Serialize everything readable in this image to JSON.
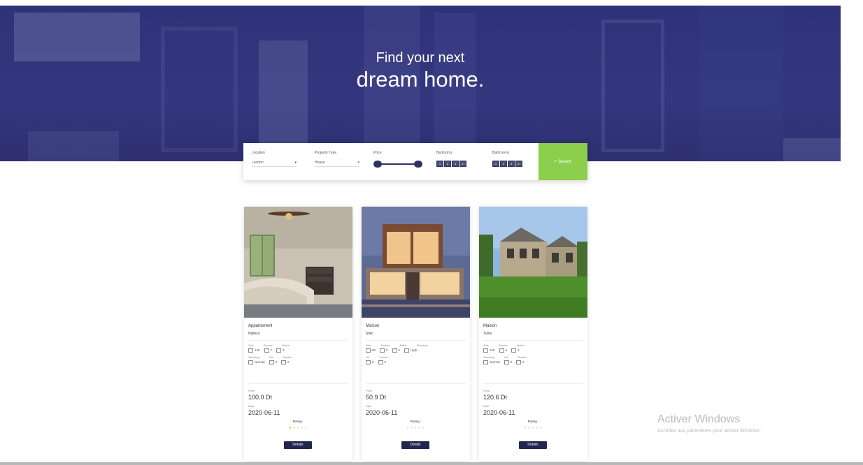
{
  "hero": {
    "line1": "Find your next",
    "line2": "dream home."
  },
  "search": {
    "location": {
      "label": "Location",
      "value": "London"
    },
    "property_type": {
      "label": "Property Type",
      "value": "House"
    },
    "price": {
      "label": "Price",
      "min_fraction": 0,
      "max_fraction": 1
    },
    "bedrooms": {
      "label": "Bedrooms",
      "options": [
        "1",
        "2",
        "3",
        "4+"
      ]
    },
    "bathrooms": {
      "label": "Bathrooms",
      "options": [
        "1",
        "2",
        "3",
        "4+"
      ]
    },
    "button_label": "Search",
    "accent_color": "#8ccf4d"
  },
  "cards": [
    {
      "type": "Appartement",
      "city": "Nabeul",
      "spec_headers": [
        "Size",
        "Rooms",
        "Baths"
      ],
      "specs": [
        {
          "icon": "area-icon",
          "value": "120"
        },
        {
          "icon": "bed-icon",
          "value": "7"
        },
        {
          "icon": "bath-icon",
          "value": "3"
        }
      ],
      "spec_headers2": [
        "Standing",
        "Lift",
        "Garden"
      ],
      "specs2": [
        {
          "icon": "standing-icon",
          "value": "Normal"
        },
        {
          "icon": "lift-icon",
          "value": "0"
        },
        {
          "icon": "garden-icon",
          "value": "0"
        }
      ],
      "price_label": "Price",
      "price": "100.0 Dt",
      "date_label": "Date",
      "date": "2020-06-11",
      "rating_label": "Rating :",
      "rating": 1,
      "details_label": "Details"
    },
    {
      "type": "Maison",
      "city": "Sfax",
      "spec_headers": [
        "Size",
        "Rooms",
        "Baths",
        "Standing"
      ],
      "specs": [
        {
          "icon": "area-icon",
          "value": "90"
        },
        {
          "icon": "bed-icon",
          "value": "6"
        },
        {
          "icon": "bath-icon",
          "value": "2"
        },
        {
          "icon": "standing-icon",
          "value": "High"
        }
      ],
      "spec_headers2": [
        "Lift",
        "Garden"
      ],
      "specs2": [
        {
          "icon": "lift-icon",
          "value": "0"
        },
        {
          "icon": "garden-icon",
          "value": "0"
        }
      ],
      "price_label": "Price",
      "price": "50.9 Dt",
      "date_label": "Date",
      "date": "2020-06-11",
      "rating_label": "Rating :",
      "rating": 0,
      "details_label": "Details"
    },
    {
      "type": "Maison",
      "city": "Tunis",
      "spec_headers": [
        "Size",
        "Rooms",
        "Baths"
      ],
      "specs": [
        {
          "icon": "area-icon",
          "value": "120"
        },
        {
          "icon": "bed-icon",
          "value": "6"
        },
        {
          "icon": "bath-icon",
          "value": "3"
        }
      ],
      "spec_headers2": [
        "Standing",
        "Lift",
        "Garden"
      ],
      "specs2": [
        {
          "icon": "standing-icon",
          "value": "Normal"
        },
        {
          "icon": "lift-icon",
          "value": "0"
        },
        {
          "icon": "garden-icon",
          "value": "0"
        }
      ],
      "price_label": "Price",
      "price": "120.6 Dt",
      "date_label": "Date",
      "date": "2020-06-11",
      "rating_label": "Rating :",
      "rating": 0,
      "details_label": "Details"
    }
  ],
  "watermark": {
    "title": "Activer Windows",
    "subtitle": "Accédez aux paramètres pour activer Windows."
  }
}
